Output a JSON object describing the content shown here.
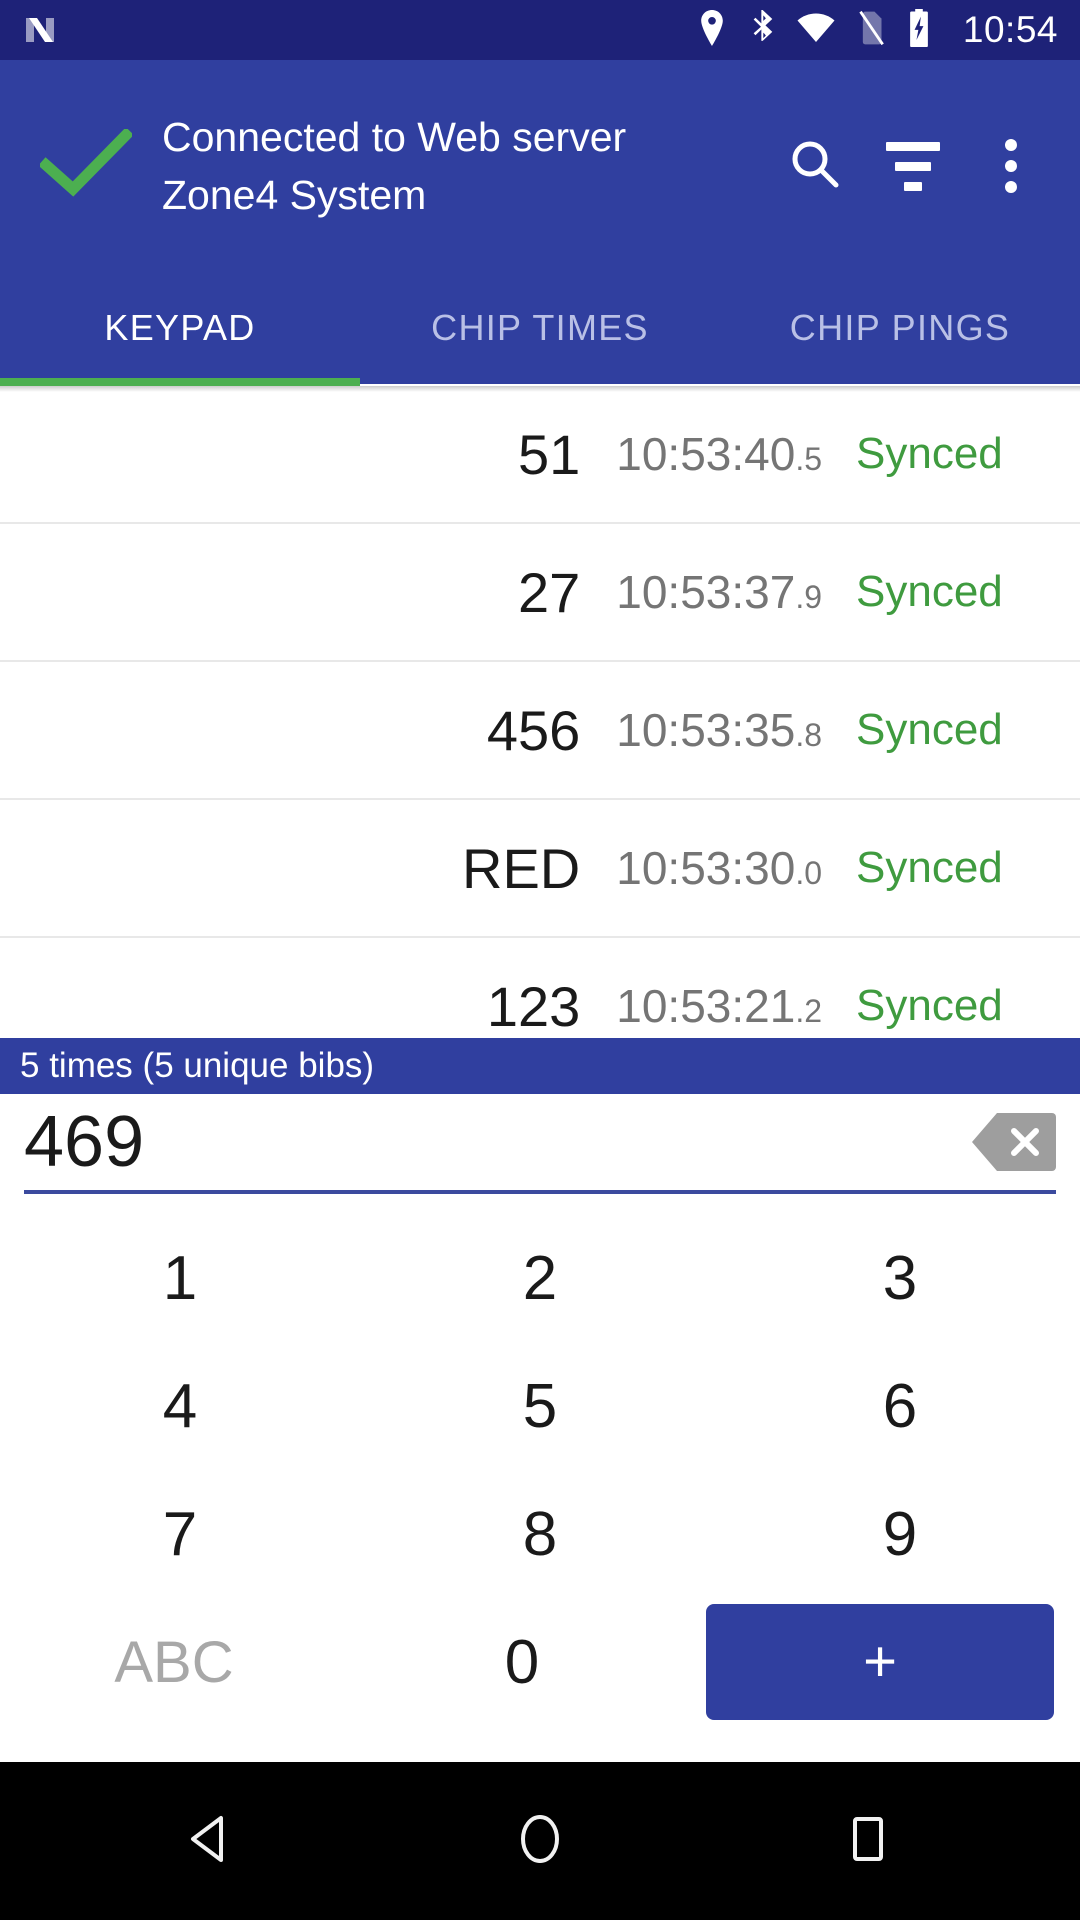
{
  "status_bar": {
    "logo": "android-n-logo",
    "icons": [
      "location-icon",
      "bluetooth-icon",
      "wifi-icon",
      "sim-off-icon",
      "battery-charging-icon"
    ],
    "clock": "10:54"
  },
  "app_bar": {
    "connection_icon": "check-icon",
    "title_line1": "Connected to Web server",
    "title_line2": "Zone4 System",
    "actions": [
      {
        "name": "search-icon",
        "label": "Search"
      },
      {
        "name": "filter-icon",
        "label": "Filter"
      },
      {
        "name": "overflow-menu-icon",
        "label": "More options"
      }
    ]
  },
  "tabs": {
    "items": [
      {
        "label": "KEYPAD",
        "active": true
      },
      {
        "label": "CHIP TIMES",
        "active": false
      },
      {
        "label": "CHIP PINGS",
        "active": false
      }
    ]
  },
  "times_list": {
    "rows": [
      {
        "bib": "51",
        "time": "10:53:40",
        "frac": ".5",
        "status": "Synced"
      },
      {
        "bib": "27",
        "time": "10:53:37",
        "frac": ".9",
        "status": "Synced"
      },
      {
        "bib": "456",
        "time": "10:53:35",
        "frac": ".8",
        "status": "Synced"
      },
      {
        "bib": "RED",
        "time": "10:53:30",
        "frac": ".0",
        "status": "Synced"
      },
      {
        "bib": "123",
        "time": "10:53:21",
        "frac": ".2",
        "status": "Synced"
      }
    ]
  },
  "keypad": {
    "summary": "5 times (5 unique bibs)",
    "input_value": "469",
    "input_placeholder": "",
    "backspace_icon": "backspace-icon",
    "rows": [
      [
        "1",
        "2",
        "3"
      ],
      [
        "4",
        "5",
        "6"
      ],
      [
        "7",
        "8",
        "9"
      ]
    ],
    "alpha_label": "ABC",
    "zero_label": "0",
    "add_label": "+"
  },
  "nav_bar": {
    "back": "back-icon",
    "home": "home-icon",
    "recents": "recents-icon"
  },
  "colors": {
    "status_bar": "#1e2278",
    "app_bar": "#303f9f",
    "accent_green": "#4caf50",
    "synced_green": "#3f9b3f",
    "time_gray": "#757575",
    "nav_bar": "#000000"
  }
}
